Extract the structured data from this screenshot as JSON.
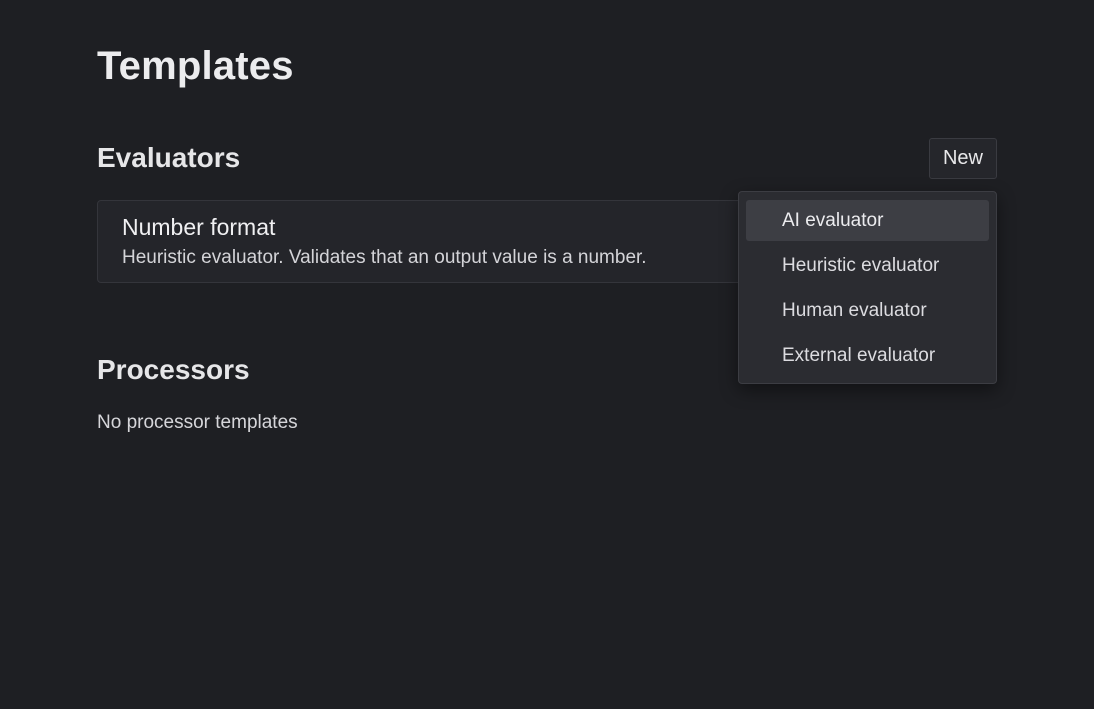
{
  "page": {
    "title": "Templates"
  },
  "evaluators": {
    "title": "Evaluators",
    "new_label": "New",
    "items": [
      {
        "name": "Number format",
        "description": "Heuristic evaluator. Validates that an output value is a number."
      }
    ]
  },
  "new_menu": {
    "items": [
      {
        "label": "AI evaluator"
      },
      {
        "label": "Heuristic evaluator"
      },
      {
        "label": "Human evaluator"
      },
      {
        "label": "External evaluator"
      }
    ]
  },
  "processors": {
    "title": "Processors",
    "empty_text": "No processor templates"
  }
}
